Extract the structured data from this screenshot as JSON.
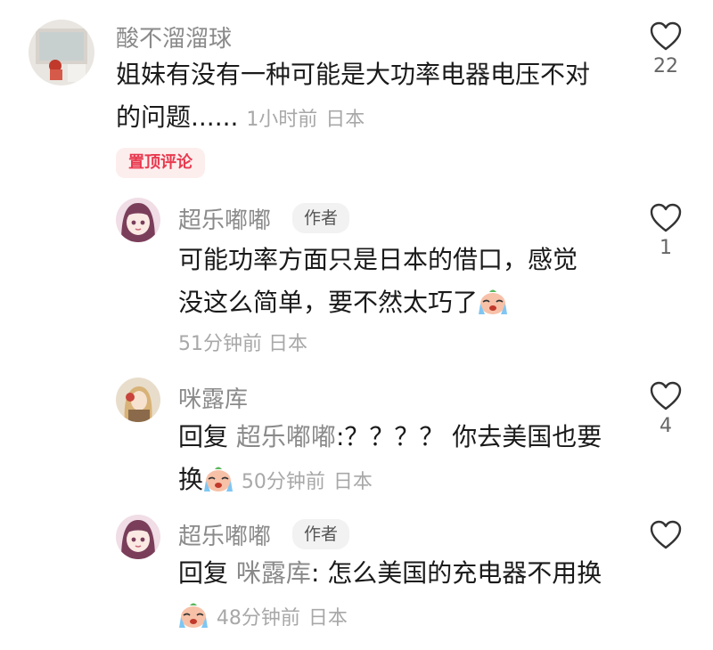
{
  "comments": [
    {
      "username": "酸不溜溜球",
      "text_line1": "姐妹有没有一种可能是大功率电器电压不对",
      "text_line2": "的问题......",
      "time": "1小时前",
      "location": "日本",
      "badge": "置顶评论",
      "likes": "22",
      "avatar_icon": "photo-avatar-icon"
    }
  ],
  "replies": [
    {
      "username": "超乐嘟嘟",
      "author_badge": "作者",
      "text_line1": "可能功率方面只是日本的借口，感觉",
      "text_line2": "没这么简单，要不然太巧了",
      "emoji": "crying-face-icon",
      "time": "51分钟前",
      "location": "日本",
      "likes": "1"
    },
    {
      "username": "咪露库",
      "reply_prefix": "回复",
      "reply_to": "超乐嘟嘟",
      "text_line1_rest": ":？？？？ 你去美国也要",
      "text_line2": "换",
      "emoji": "crying-face-icon",
      "time": "50分钟前",
      "location": "日本",
      "likes": "4"
    },
    {
      "username": "超乐嘟嘟",
      "author_badge": "作者",
      "reply_prefix": "回复",
      "reply_to": "咪露库",
      "text_line1_rest": ": 怎么美国的充电器不用换",
      "emoji": "crying-face-icon",
      "time": "48分钟前",
      "location": "日本",
      "likes": ""
    }
  ],
  "colors": {
    "pin_badge_bg": "#fdeeee",
    "pin_badge_text": "#e83a4f",
    "username": "#8a8a8a",
    "meta": "#a8a8a8"
  }
}
